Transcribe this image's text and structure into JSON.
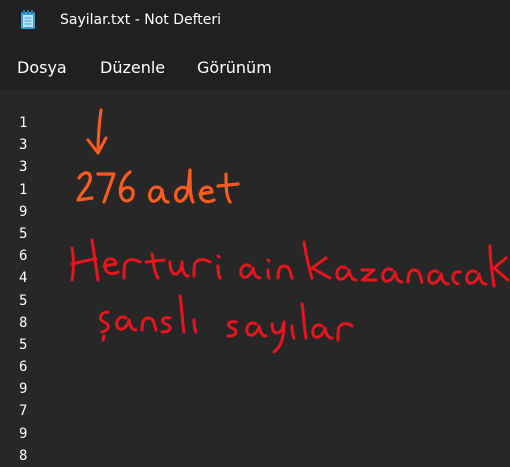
{
  "window": {
    "title": "Sayilar.txt - Not Defteri",
    "app_icon": "notepad-icon"
  },
  "menu": {
    "items": [
      "Dosya",
      "Düzenle",
      "Görünüm"
    ]
  },
  "editor": {
    "lines": [
      "1",
      "3",
      "3",
      "1",
      "9",
      "5",
      "6",
      "4",
      "5",
      "8",
      "5",
      "6",
      "9",
      "7",
      "9",
      "8"
    ]
  },
  "annotations": {
    "arrow": "arrow-down",
    "count_note": "276 adet",
    "line1": "Her turi ain kazanacak",
    "line2": "şanslı sayılar",
    "colors": {
      "orange": "#ff5a1f",
      "red": "#e8141e"
    }
  },
  "colors": {
    "titlebar_bg": "#202020",
    "editor_bg": "#272727",
    "text": "#ffffff"
  }
}
